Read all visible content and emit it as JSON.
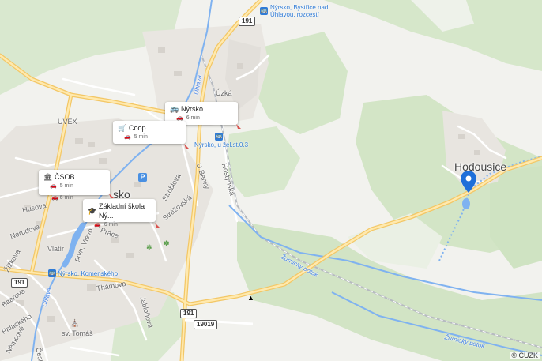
{
  "map": {
    "colors": {
      "background": "#f2f2ee",
      "forest": "#d4e6c8",
      "builtup": "#e6e3df",
      "road_major": "#f7d27a",
      "road_minor": "#ffffff",
      "water": "#7fb2f0",
      "railway": "#9aa0a6",
      "pin": "#1e6fd9"
    },
    "towns": {
      "hodousice": "Hodousice",
      "nyrsko_partial": "sko"
    },
    "places": {
      "uzka": "Úzká",
      "uvex": "UVEX",
      "vlatir": "Vlatír",
      "sv_tomas": "sv. Tomáš"
    },
    "streets": {
      "husova": "Husova",
      "nerudova": "Nerudova",
      "prace": "Práce",
      "thamova": "Thámova",
      "jabloňova": "Jabloňová",
      "zizkova": "Žižkova",
      "baarova": "Baarova",
      "palackeho": "Palackého",
      "nemcove": "Němcové",
      "cesk": "Česk",
      "u_benky": "U Benky",
      "hostynska": "Hostýnská",
      "stroblova": "Stroblova",
      "strazovska": "Strážovská",
      "zatecka": "Žatecká",
      "prvni_vlevo": "prvn. Vlevo"
    },
    "streams": {
      "uhlava_north": "Úhlava",
      "uhlava_south": "Úhlava",
      "zurnicky_potok_1": "Žurnický potok",
      "zurnicky_potok_2": "Žurnický potok"
    },
    "road_numbers": {
      "r191_top": "191",
      "r191_left": "191",
      "r191_bottom": "191",
      "r19019": "19019"
    },
    "transit_stops": {
      "bystrice": "Nýrsko, Bystřice nad Úhlavou, rozcestí",
      "bystrice_line1": "Nýrsko, Bystřice nad",
      "bystrice_line2": "Úhlavou, rozcestí",
      "zel_st": "Nýrsko, u žel.st.0.3",
      "komenskeho": "Nýrsko, Komenského"
    },
    "popups": [
      {
        "title": "Nýrsko",
        "icon": "bus-icon",
        "time": "6 min"
      },
      {
        "title": "Coop",
        "icon": "cart-icon",
        "time": "5 min"
      },
      {
        "title": "ČSOB",
        "icon": "bank-icon",
        "time": "5 min",
        "extra_time": "6 min"
      },
      {
        "title": "Základní škola Ný...",
        "icon": "school-icon",
        "time": "6 min"
      }
    ],
    "copyright": "© ČÚZK"
  }
}
